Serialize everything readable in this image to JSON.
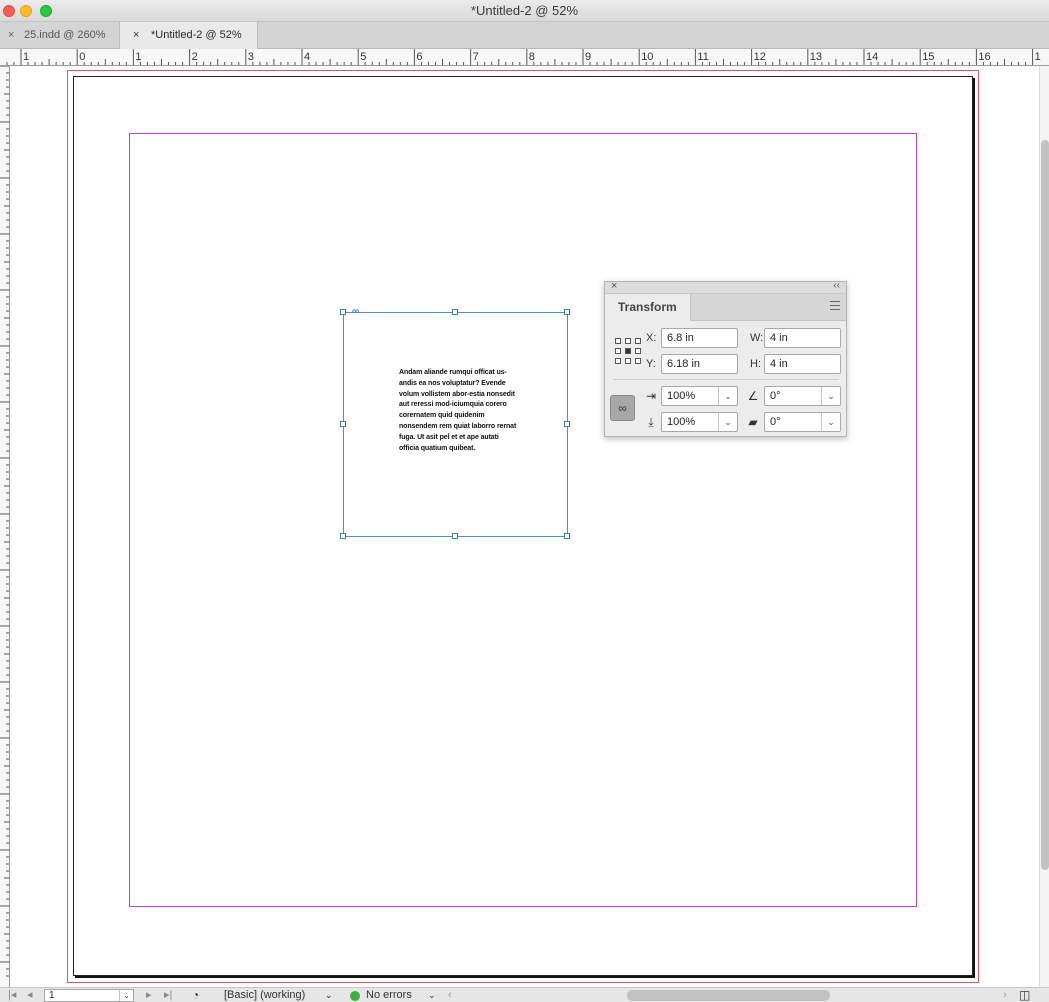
{
  "window": {
    "title": "*Untitled-2 @ 52%"
  },
  "tabs": [
    {
      "label": "25.indd @ 260%",
      "close": "×"
    },
    {
      "label": "*Untitled-2 @ 52%",
      "close": "×"
    }
  ],
  "rulers": {
    "horizontal_labels": [
      "1",
      "0",
      "1",
      "2",
      "3",
      "4",
      "5",
      "6",
      "7",
      "8",
      "9",
      "10",
      "11",
      "12",
      "13",
      "14",
      "15",
      "16",
      "1"
    ]
  },
  "frame": {
    "text": "Andam aliande rumqui officat us-andis ea nos voluptatur? Evende volum vollistem abor-estia nonsedit aut reressi mod-iciumquia corero corernatem quid quidenim nonsendem rem quiat laborro rernat fuga. Ut asit pel et et ape autati officia quatium quibeat.",
    "link_icon": "link-icon",
    "selection_color": "#4a8fd4"
  },
  "guides": {
    "bleed_color": "#e8545a",
    "margin_color": "#c43fcf"
  },
  "transform_panel": {
    "close": "×",
    "collapse": "‹‹",
    "title": "Transform",
    "x_label": "X:",
    "x_value": "6.8 in",
    "y_label": "Y:",
    "y_value": "6.18 in",
    "w_label": "W:",
    "w_value": "4 in",
    "h_label": "H:",
    "h_value": "4 in",
    "scale_x": "100%",
    "scale_y": "100%",
    "rotation": "0°",
    "shear": "0°"
  },
  "statusbar": {
    "page": "1",
    "preflight_profile": "[Basic] (working)",
    "status": "No errors",
    "status_color": "#3cb043"
  }
}
